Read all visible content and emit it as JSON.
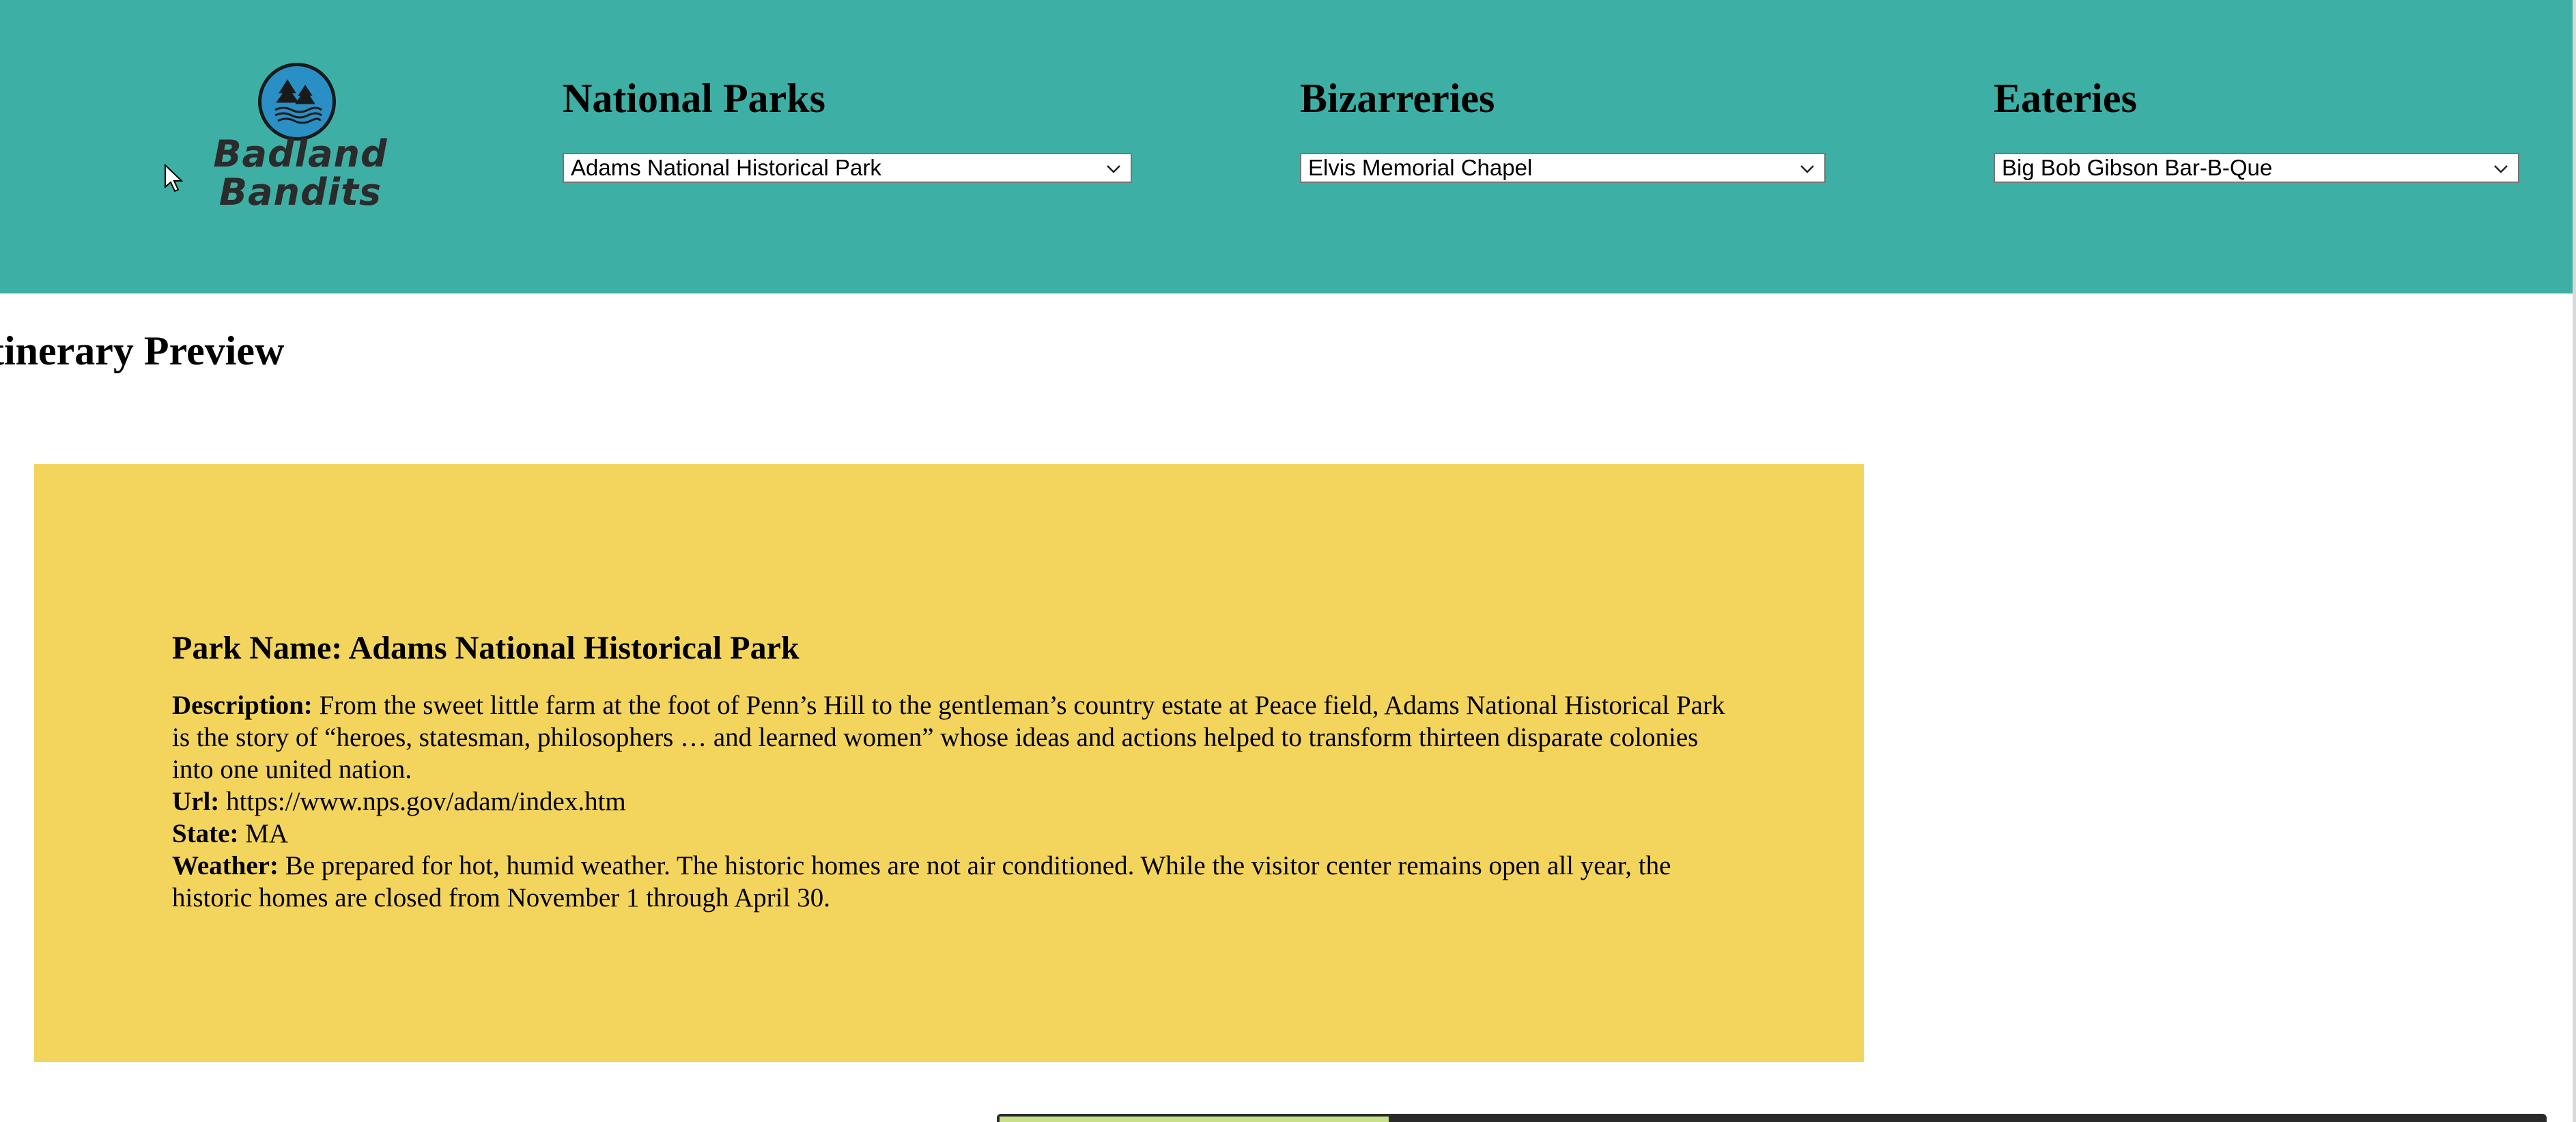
{
  "colors": {
    "header_bg": "#3dafa5",
    "card_bg": "#f3d55d",
    "logo_circle": "#2a8fc4"
  },
  "logo": {
    "line1": "Badland",
    "line2": "Bandits",
    "icon": "trees-and-waves-icon"
  },
  "nav": {
    "parks": {
      "heading": "National Parks",
      "selected": "Adams National Historical Park"
    },
    "bizarreries": {
      "heading": "Bizarreries",
      "selected": "Elvis Memorial Chapel"
    },
    "eateries": {
      "heading": "Eateries",
      "selected": "Big Bob Gibson Bar-B-Que"
    }
  },
  "itinerary": {
    "title": "tinerary Preview"
  },
  "park": {
    "name_label": "Park Name: Adams National Historical Park",
    "description_label": "Description:",
    "description": "From the sweet little farm at the foot of Penn’s Hill to the gentleman’s country estate at Peace field, Adams National Historical Park is the story of “heroes, statesman, philosophers … and learned women” whose ideas and actions helped to transform thirteen disparate colonies into one united nation.",
    "url_label": "Url:",
    "url": "https://www.nps.gov/adam/index.htm",
    "state_label": "State:",
    "state": "MA",
    "weather_label": "Weather:",
    "weather": "Be prepared for hot, humid weather. The historic homes are not air conditioned. While the visitor center remains open all year, the historic homes are closed from November 1 through April 30."
  }
}
